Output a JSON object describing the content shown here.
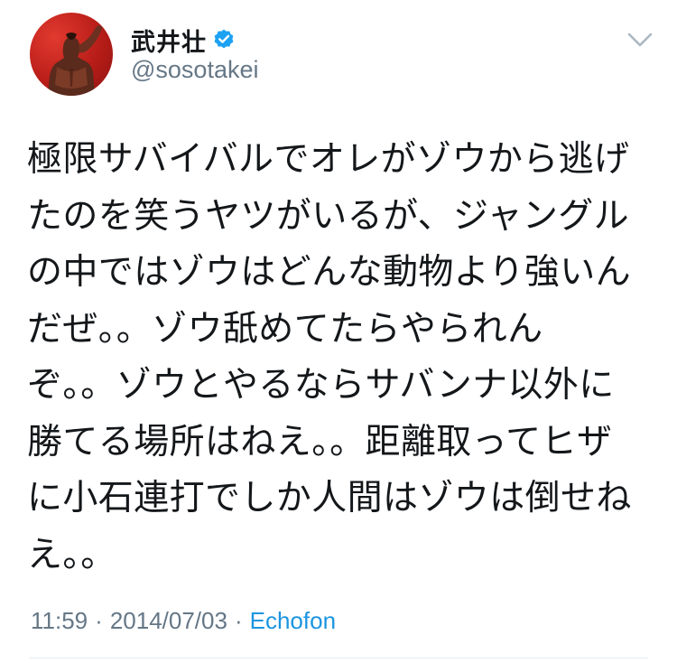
{
  "user": {
    "display_name": "武井壮",
    "handle": "@sosotakei",
    "verified": true
  },
  "icons": {
    "avatar": "profile-photo",
    "verified": "verified-badge-icon",
    "menu": "chevron-down-icon"
  },
  "tweet": {
    "lines": [
      "極限サバイバルでオレがゾウから逃げ",
      "たのを笑うヤツがいるが、ジャングル",
      "の中ではゾウはどんな動物より強いん",
      "だぜ。。ゾウ舐めてたらやられん",
      "ぞ。。ゾウとやるならサバンナ以外に",
      "勝てる場所はねえ。。距離取ってヒザ",
      "に小石連打でしか人間はゾウは倒せね",
      "え。。"
    ]
  },
  "meta": {
    "time": "11:59",
    "separator": "·",
    "date": "2014/07/03",
    "source": "Echofon"
  },
  "colors": {
    "text": "#14171a",
    "secondary": "#657786",
    "link": "#1b95e0",
    "verified": "#1da1f2",
    "avatar_bg": "#c8231d"
  }
}
